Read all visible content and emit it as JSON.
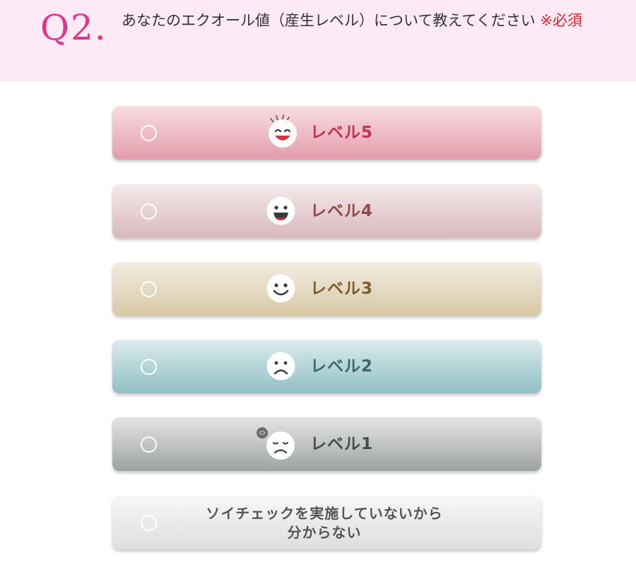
{
  "question": {
    "number": "Q2.",
    "text": "あなたのエクオール値（産生レベル）について教えてください",
    "required_mark": "※必須"
  },
  "options": [
    {
      "label": "レベル5",
      "face": "big-smile-face-icon",
      "text_color": "#c2334e",
      "gradient": [
        "#f9dde3",
        "#e39cac"
      ]
    },
    {
      "label": "レベル4",
      "face": "grin-face-icon",
      "text_color": "#8c4a48",
      "gradient": [
        "#f5eaeb",
        "#d7b8bc"
      ]
    },
    {
      "label": "レベル3",
      "face": "smile-face-icon",
      "text_color": "#7a5e2e",
      "gradient": [
        "#f3ede2",
        "#d8c8a4"
      ]
    },
    {
      "label": "レベル2",
      "face": "frown-face-icon",
      "text_color": "#3c6871",
      "gradient": [
        "#dcebee",
        "#8fc0c4"
      ]
    },
    {
      "label": "レベル1",
      "face": "sad-face-icon",
      "text_color": "#454d4f",
      "gradient": [
        "#e3e5e4",
        "#9da3a1"
      ]
    },
    {
      "label_line1": "ソイチェックを実施していないから",
      "label_line2": "分からない",
      "text_color": "#555555",
      "gradient": [
        "#f7f7f7",
        "#dedede"
      ]
    }
  ]
}
